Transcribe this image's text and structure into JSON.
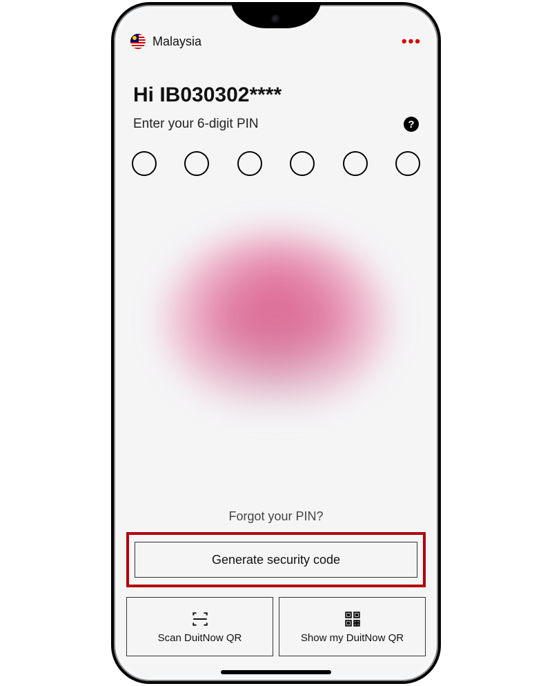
{
  "header": {
    "country_label": "Malaysia",
    "more_glyph": "•••"
  },
  "greeting": "Hi IB030302****",
  "pin_prompt": "Enter your 6-digit PIN",
  "help_glyph": "?",
  "pin_length": 6,
  "forgot_label": "Forgot your PIN?",
  "security_button_label": "Generate security code",
  "qr": {
    "scan_label": "Scan DuitNow QR",
    "show_label": "Show my DuitNow QR"
  },
  "colors": {
    "highlight": "#b3000a",
    "accent_red": "#d40000"
  }
}
